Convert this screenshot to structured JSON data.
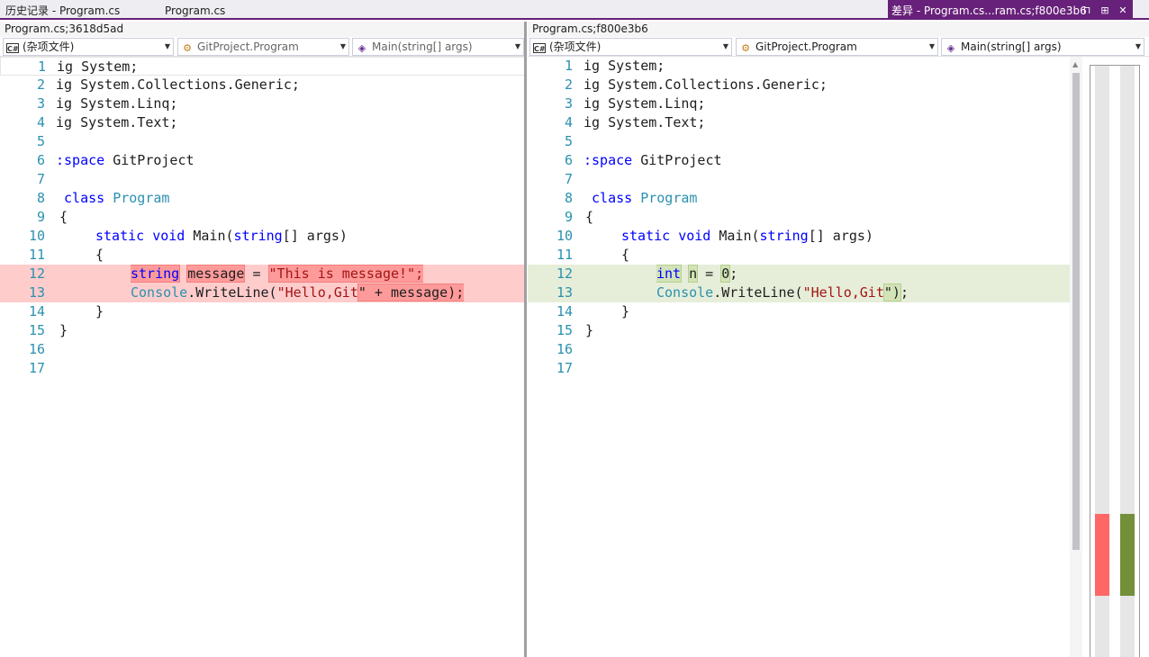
{
  "tabs": {
    "history": "历史记录 - Program.cs",
    "program": "Program.cs",
    "diff": "差异 - Program.cs...ram.cs;f800e3b6",
    "diff_icons": [
      "pin-icon",
      "maximize-icon",
      "close-icon"
    ],
    "diff_icon_glyphs": [
      "⊓",
      "⊞",
      "✕"
    ]
  },
  "left": {
    "title": "Program.cs;3618d5ad",
    "nav": {
      "project": "(杂项文件)",
      "class": "GitProject.Program",
      "member": "Main(string[] args)"
    }
  },
  "right": {
    "title": "Program.cs;f800e3b6",
    "nav": {
      "project": "(杂项文件)",
      "class": "GitProject.Program",
      "member": "Main(string[] args)"
    }
  },
  "code_common": {
    "line_numbers": [
      "1",
      "2",
      "3",
      "4",
      "5",
      "6",
      "7",
      "8",
      "9",
      "10",
      "11",
      "12",
      "13",
      "14",
      "15",
      "16",
      "17"
    ],
    "l1": "ig System;",
    "l2": "ig System.Collections.Generic;",
    "l3": "ig System.Linq;",
    "l4": "ig System.Text;",
    "l6_kw": ":space",
    "l6_name": " GitProject",
    "l8_kw": "class",
    "l8_name": "Program",
    "l9": "{",
    "l10_static": "static",
    "l10_void": "void",
    "l10_main": " Main(",
    "l10_string": "string",
    "l10_rest": "[] args)",
    "l11": "{",
    "l13_console": "Console",
    "l13_write": ".WriteLine(",
    "l14": "}",
    "l15": "}"
  },
  "diff_left": {
    "l12_type": "string",
    "l12_var": "message",
    "l12_eq": " = ",
    "l12_str": "\"This is message!\";",
    "l13_str": "\"Hello,Git",
    "l13_hl": "\" + message);"
  },
  "diff_right": {
    "l12_type": "int",
    "l12_var": "n",
    "l12_eq": " = ",
    "l12_num": "0",
    "l12_end": ";",
    "l13_str": "\"Hello,Git",
    "l13_hl": "\")",
    "l13_end": ";"
  },
  "colors": {
    "accent": "#68217a",
    "deleted_marker": "#ff6666",
    "added_marker": "#738f3a"
  }
}
